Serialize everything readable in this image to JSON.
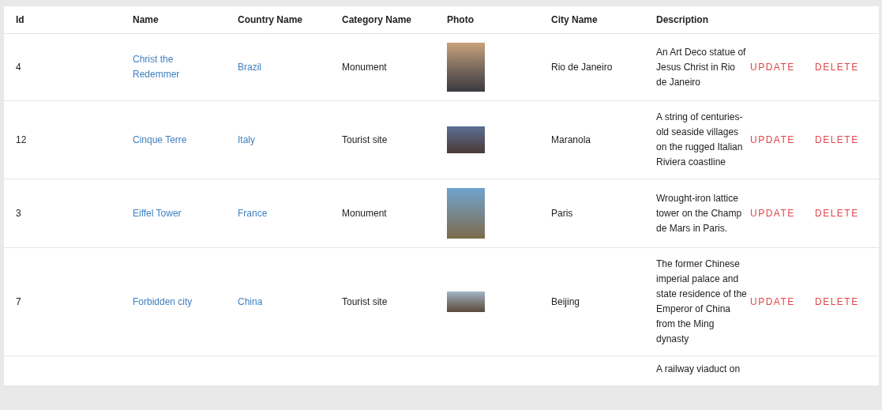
{
  "table": {
    "columns": [
      "Id",
      "Name",
      "Country Name",
      "Category Name",
      "Photo",
      "City Name",
      "Description"
    ],
    "rows": [
      {
        "id": "4",
        "name": "Christ the Redemmer",
        "country": "Brazil",
        "category": "Monument",
        "city": "Rio de Janeiro",
        "description": "An Art Deco statue of Jesus Christ in Rio de Janeiro",
        "actions": [
          "UPDATE",
          "DELETE"
        ]
      },
      {
        "id": "12",
        "name": "Cinque Terre",
        "country": "Italy",
        "category": "Tourist site",
        "city": "Maranola",
        "description": "A string of centuries-old seaside villages on the rugged Italian Riviera coastline",
        "actions": [
          "UPDATE",
          "DELETE"
        ]
      },
      {
        "id": "3",
        "name": "Eiffel Tower",
        "country": "France",
        "category": "Monument",
        "city": "Paris",
        "description": "Wrought-iron lattice tower on the Champ de Mars in Paris.",
        "actions": [
          "UPDATE",
          "DELETE"
        ]
      },
      {
        "id": "7",
        "name": "Forbidden city",
        "country": "China",
        "category": "Tourist site",
        "city": "Beijing",
        "description": "The former Chinese imperial palace and state residence of the Emperor of China from the Ming dynasty",
        "actions": [
          "UPDATE",
          "DELETE"
        ]
      },
      {
        "description": "A railway viaduct on"
      }
    ]
  }
}
